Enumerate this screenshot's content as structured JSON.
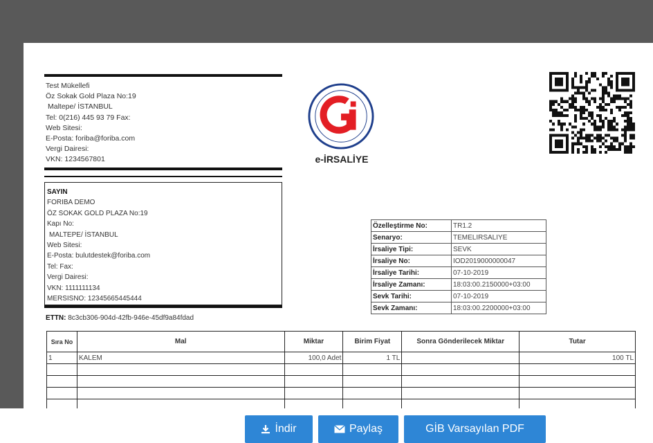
{
  "sender": {
    "name": "Test Mükellefi",
    "address": "Öz Sokak Gold Plaza No:19",
    "city": "Maltepe/ İSTANBUL",
    "phone": "Tel: 0(216) 445 93 79 Fax:",
    "web": "Web Sitesi:",
    "email": "E-Posta: foriba@foriba.com",
    "tax_office": "Vergi Dairesi:",
    "vkn": "VKN: 1234567801"
  },
  "document_title": "e-İRSALİYE",
  "logo": {
    "icon": "gib-logo-icon",
    "color": "#e31e24",
    "ring_color": "#1f3f8c"
  },
  "recipient": {
    "heading": "SAYIN",
    "name": "FORIBA DEMO",
    "address": "ÖZ SOKAK GOLD PLAZA No:19",
    "door": "Kapı No:",
    "city": "MALTEPE/ İSTANBUL",
    "web": "Web Sitesi:",
    "email": "E-Posta: bulutdestek@foriba.com",
    "phone": "Tel: Fax:",
    "tax_office": "Vergi Dairesi:",
    "vkn": "VKN: 1111111134",
    "mersis": "MERSISNO: 12345665445444"
  },
  "ettn": {
    "label": "ETTN:",
    "value": "8c3cb306-904d-42fb-946e-45df9a84fdad"
  },
  "meta": [
    {
      "key": "Özelleştirme No:",
      "value": "TR1.2"
    },
    {
      "key": "Senaryo:",
      "value": "TEMELIRSALIYE"
    },
    {
      "key": "İrsaliye Tipi:",
      "value": "SEVK"
    },
    {
      "key": "İrsaliye No:",
      "value": "IOD2019000000047"
    },
    {
      "key": "İrsaliye Tarihi:",
      "value": "07-10-2019"
    },
    {
      "key": "İrsaliye Zamanı:",
      "value": "18:03:00.2150000+03:00"
    },
    {
      "key": "Sevk Tarihi:",
      "value": "07-10-2019"
    },
    {
      "key": "Sevk Zamanı:",
      "value": "18:03:00.2200000+03:00"
    }
  ],
  "items_table": {
    "headers": [
      "Sıra No",
      "Mal",
      "Miktar",
      "Birim Fiyat",
      "Sonra Gönderilecek Miktar",
      "Tutar"
    ],
    "rows": [
      [
        "1",
        "KALEM",
        "100,0 Adet",
        "1 TL",
        "",
        "100 TL"
      ]
    ]
  },
  "buttons": {
    "download": {
      "label": "İndir",
      "icon": "download-icon"
    },
    "share": {
      "label": "Paylaş",
      "icon": "envelope-icon"
    },
    "gib_pdf": {
      "label": "GİB Varsayılan PDF"
    }
  },
  "colors": {
    "frame": "#595959",
    "button": "#2e86d6"
  }
}
